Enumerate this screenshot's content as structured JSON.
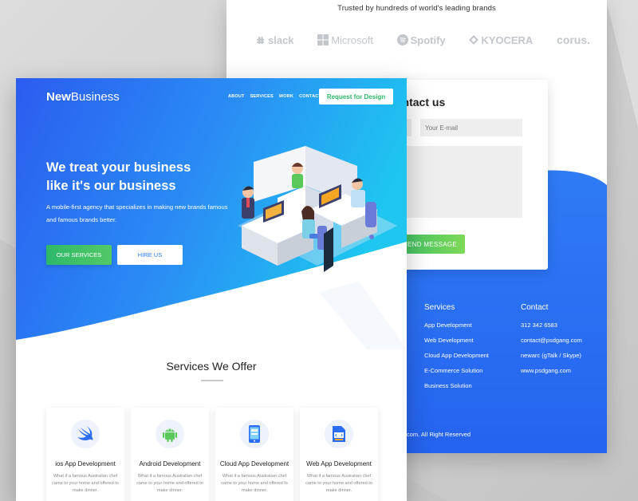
{
  "back_page": {
    "trusted_text": "Trusted by hundreds of world's leading brands",
    "brands": [
      {
        "label": "slack",
        "icon": "slack-icon"
      },
      {
        "label": "Microsoft",
        "icon": "microsoft-icon"
      },
      {
        "label": "Spotify",
        "icon": "spotify-icon"
      },
      {
        "label": "KYOCERA",
        "icon": "kyocera-icon"
      },
      {
        "label": "corus.",
        "icon": ""
      }
    ],
    "contact": {
      "title": "ontact us",
      "email_placeholder": "Your E-mail",
      "send_label": "END MESSAGE"
    },
    "footer": {
      "services_heading": "Services",
      "services": [
        "App Development",
        "Web Development",
        "Cloud App Development",
        "E-Commerce Solution",
        "Business Solution"
      ],
      "contact_heading": "Contact",
      "contact_lines": [
        "312 342 6583",
        "contact@psdgang.com",
        "newarc (gTalk / Skype)",
        "www.psdgang.com"
      ],
      "copyright": "com. All Right Reserved"
    }
  },
  "front_page": {
    "logo_bold": "New",
    "logo_rest": "Business",
    "nav": [
      "ABOUT",
      "SERVICES",
      "WORK",
      "CONTACT"
    ],
    "cta_label": "Request for Design",
    "headline_line1": "We treat your business",
    "headline_line2": "like it's our business",
    "subheadline": "A mobile-first agency that specializes in making new brands famous and famous brands better.",
    "btn_services": "OUR SERVICES",
    "btn_hire": "HIRE US",
    "services_title": "Services We Offer",
    "services": [
      {
        "title": "ios App Development",
        "icon": "swift-icon",
        "desc": "What if a famous Australian chef came to your home and offered to make dinner."
      },
      {
        "title": "Android Development",
        "icon": "android-icon",
        "desc": "What if a famous Australian chef came to your home and offered to make dinner."
      },
      {
        "title": "Cloud App Development",
        "icon": "mobile-app-icon",
        "desc": "What if a famous Australian chef came to your home and offered to make dinner."
      },
      {
        "title": "Web App Development",
        "icon": "web-code-icon",
        "desc": "What if a famous Australian chef came to your home and offered to make dinner."
      }
    ]
  },
  "colors": {
    "hero_blue_start": "#2b5cf0",
    "hero_blue_end": "#1ec6f0",
    "accent_green": "#2eb86a",
    "footer_blue": "#2b6ef4"
  }
}
